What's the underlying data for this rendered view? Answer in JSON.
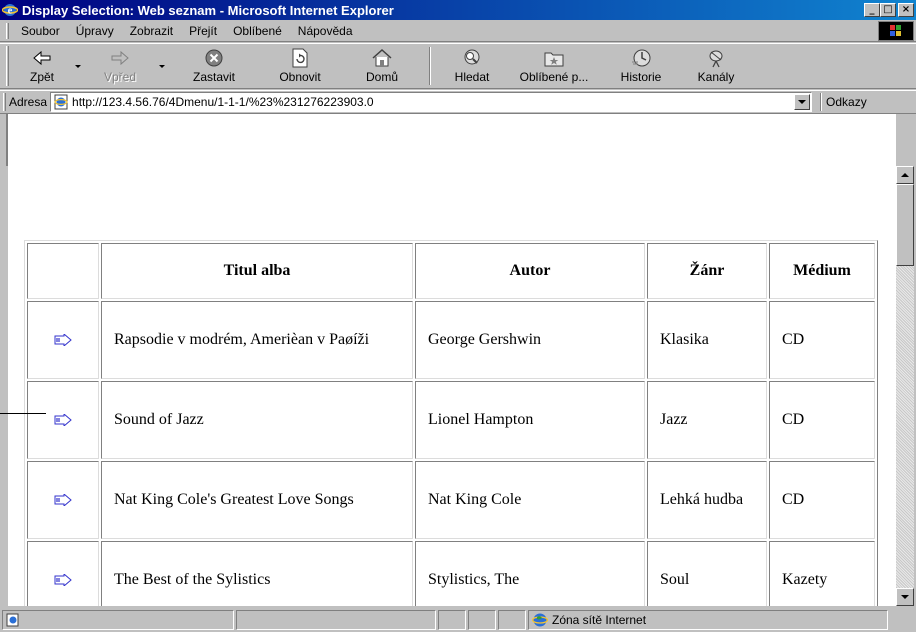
{
  "window": {
    "title": "Display Selection: Web seznam - Microsoft Internet Explorer",
    "minimize": "_",
    "maximize": "□",
    "close": "×"
  },
  "menu": {
    "items": [
      {
        "label": "Soubor"
      },
      {
        "label": "Úpravy"
      },
      {
        "label": "Zobrazit"
      },
      {
        "label": "Přejít"
      },
      {
        "label": "Oblíbené"
      },
      {
        "label": "Nápověda"
      }
    ]
  },
  "toolbar": {
    "back": "Zpět",
    "forward": "Vpřed",
    "stop": "Zastavit",
    "refresh": "Obnovit",
    "home": "Domů",
    "search": "Hledat",
    "favorites": "Oblíbené p...",
    "history": "Historie",
    "channels": "Kanály"
  },
  "address": {
    "label": "Adresa",
    "url": "http://123.4.56.76/4Dmenu/1-1-1/%23%231276223903.0",
    "links": "Odkazy"
  },
  "table": {
    "headers": [
      "",
      "Titul alba",
      "Autor",
      "Žánr",
      "Médium"
    ],
    "rows": [
      {
        "title": "Rapsodie v modrém, Amerièan v Paøíži",
        "author": "George Gershwin",
        "genre": "Klasika",
        "medium": "CD"
      },
      {
        "title": "Sound of Jazz",
        "author": "Lionel Hampton",
        "genre": "Jazz",
        "medium": "CD"
      },
      {
        "title": "Nat King Cole's Greatest Love Songs",
        "author": "Nat King Cole",
        "genre": "Lehká hudba",
        "medium": "CD"
      },
      {
        "title": "The Best of the Sylistics",
        "author": "Stylistics, The",
        "genre": "Soul",
        "medium": "Kazety"
      }
    ]
  },
  "status": {
    "zone": "Zóna sítě Internet"
  },
  "colors": {
    "title_bar_start": "#000080",
    "title_bar_end": "#1084d0",
    "chrome": "#c0c0c0",
    "arrow_icon": "#3333cc"
  }
}
